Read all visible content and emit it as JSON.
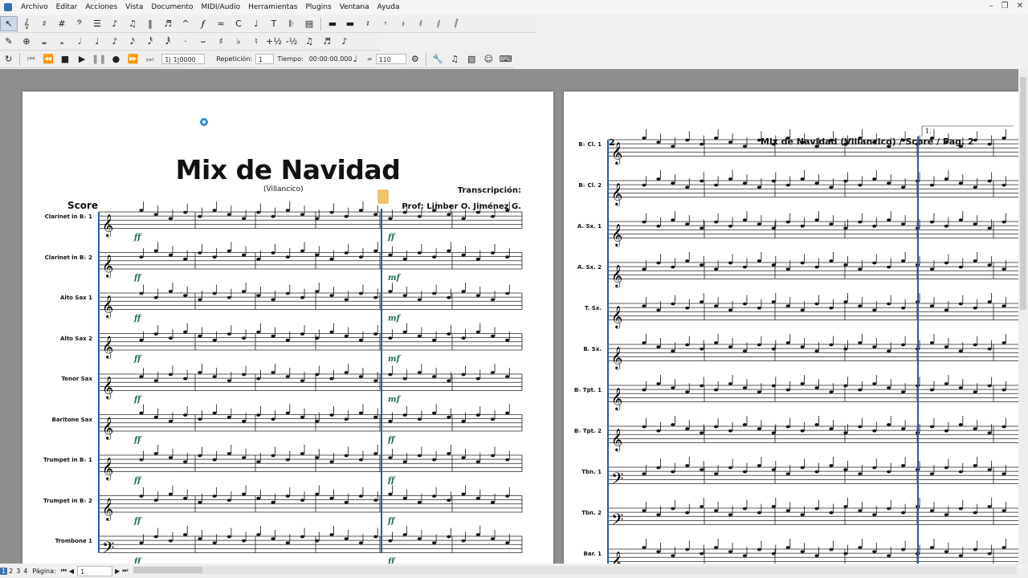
{
  "menu": [
    "Archivo",
    "Editar",
    "Acciones",
    "Vista",
    "Documento",
    "MIDI/Audio",
    "Herramientas",
    "Plugins",
    "Ventana",
    "Ayuda"
  ],
  "playback": {
    "position": "1| 1|0000",
    "repeat_label": "Repetición:",
    "repeat_value": "1",
    "time_label": "Tiempo:",
    "time_value": "00:00:00.000",
    "tempo_equals": "=",
    "tempo_value": "110"
  },
  "score": {
    "title": "Mix de Navidad",
    "subtitle": "(Villancico)",
    "transcription_label": "Transcripción:",
    "author": "Prof: Limber O. Jiménez G.",
    "part_label": "Score",
    "page1_instruments": [
      "Clarinet in B♭ 1",
      "Clarinet in B♭ 2",
      "Alto Sax 1",
      "Alto Sax 2",
      "Tenor Sax",
      "Baritone Sax",
      "Trumpet in B♭ 1",
      "Trumpet in B♭ 2",
      "Trombone 1"
    ],
    "page1_dynamics": [
      "ff",
      "ff",
      "ff",
      "ff",
      "ff",
      "ff",
      "ff",
      "ff",
      "ff"
    ],
    "page1_dynamics_b": [
      "ff",
      "mf",
      "mf",
      "mf",
      "mf",
      "ff",
      "ff",
      "ff",
      "ff"
    ],
    "page2_number": "2",
    "page2_header": "Mix de Navidad (Villancico) / Score / Pag. 2",
    "page2_instruments": [
      "B♭ Cl. 1",
      "B♭ Cl. 2",
      "A. Sx. 1",
      "A. Sx. 2",
      "T. Sx.",
      "B. Sx.",
      "B♭ Tpt. 1",
      "B♭ Tpt. 2",
      "Tbn. 1",
      "Tbn. 2",
      "Bar. 1"
    ],
    "page2_ending": "1."
  },
  "status": {
    "pages": [
      "1",
      "2",
      "3",
      "4"
    ],
    "page_label": "Página:",
    "page_value": "1"
  },
  "colors": {
    "accent": "#3a6fb5",
    "barline_blue": "#2a5aa8",
    "highlight": "#e8a73a"
  }
}
